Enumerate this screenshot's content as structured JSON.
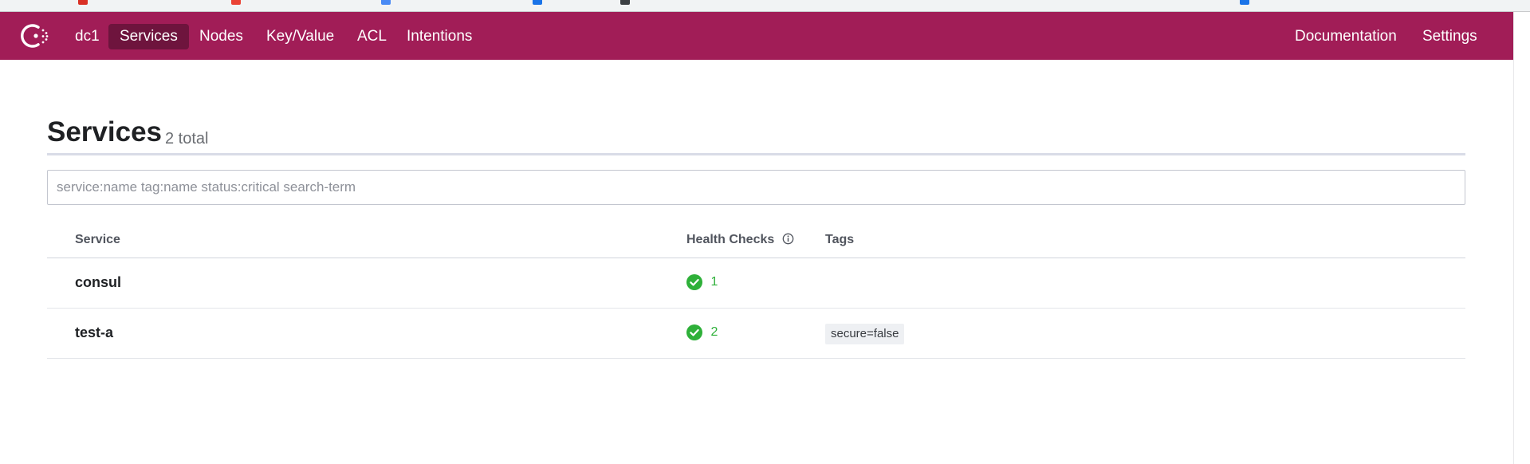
{
  "colors": {
    "brand": "#a11d57",
    "active_nav": "#6e143d",
    "passing": "#2eb039"
  },
  "icons": {
    "logo": "consul-logo-icon",
    "health_info": "info-circle-icon",
    "passing": "check-circle-icon"
  },
  "navbar": {
    "datacenter": "dc1",
    "items": [
      {
        "label": "Services",
        "active": true
      },
      {
        "label": "Nodes",
        "active": false
      },
      {
        "label": "Key/Value",
        "active": false
      },
      {
        "label": "ACL",
        "active": false
      },
      {
        "label": "Intentions",
        "active": false
      }
    ],
    "right": [
      {
        "label": "Documentation"
      },
      {
        "label": "Settings"
      }
    ]
  },
  "page": {
    "title": "Services",
    "count": "2 total"
  },
  "search": {
    "placeholder": "service:name tag:name status:critical search-term",
    "value": ""
  },
  "table": {
    "headers": [
      "Service",
      "Health Checks",
      "Tags"
    ],
    "rows": [
      {
        "service": "consul",
        "health_passing": "1",
        "tags": []
      },
      {
        "service": "test-a",
        "health_passing": "2",
        "tags": [
          "secure=false"
        ]
      }
    ]
  }
}
